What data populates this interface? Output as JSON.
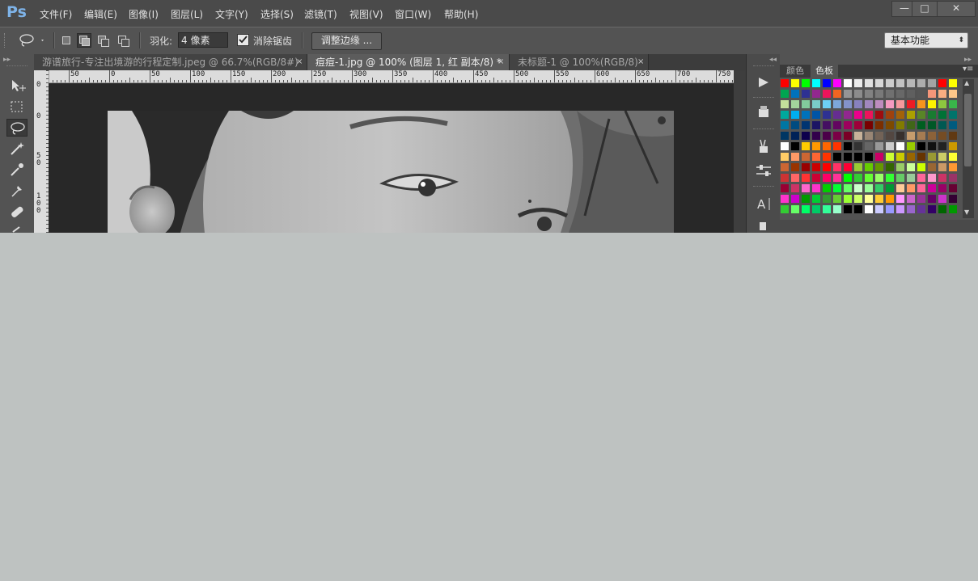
{
  "app": {
    "logo": "Ps",
    "menu": [
      "文件(F)",
      "编辑(E)",
      "图像(I)",
      "图层(L)",
      "文字(Y)",
      "选择(S)",
      "滤镜(T)",
      "视图(V)",
      "窗口(W)",
      "帮助(H)"
    ],
    "window_controls": {
      "minimize": "—",
      "maximize": "□",
      "close": "✕"
    }
  },
  "options": {
    "feather_label": "羽化:",
    "feather_value": "4 像素",
    "antialias_label": "消除锯齿",
    "antialias_checked": true,
    "refine_edge_label": "调整边缘 ...",
    "workspace": "基本功能"
  },
  "tabs": [
    {
      "label": "游谱旅行-专注出境游的行程定制.jpeg @ 66.7%(RGB/8#)",
      "close": "×",
      "active": false
    },
    {
      "label": "痘痘-1.jpg @ 100% (图层 1, 红 副本/8) *",
      "close": "×",
      "active": true
    },
    {
      "label": "未标题-1 @ 100%(RGB/8)",
      "close": "×",
      "active": false
    }
  ],
  "ruler": {
    "top_labels": [
      "50",
      "0",
      "50",
      "100",
      "150",
      "200",
      "250",
      "300",
      "350",
      "400",
      "450",
      "500",
      "550",
      "600",
      "650",
      "700",
      "750"
    ],
    "left_labels": [
      "0",
      "0",
      "5\n0",
      "1\n0\n0"
    ]
  },
  "panel": {
    "tabs": [
      "颜色",
      "色板"
    ],
    "active_tab": "色板",
    "collapse_arrows": "◂◂",
    "expand_arrows": "▸▸",
    "menu_icon": "▾≡"
  },
  "swatches": [
    "#ff0000",
    "#ffff00",
    "#00ff00",
    "#00ffff",
    "#0000ff",
    "#ff00ff",
    "#ffffff",
    "#ebebeb",
    "#e1e1e1",
    "#d7d7d7",
    "#cccccc",
    "#c2c2c2",
    "#b7b7b7",
    "#adadad",
    "#a3a3a3",
    "#ff0000",
    "#ffff00",
    "#00a651",
    "#0072bc",
    "#2e3192",
    "#92278f",
    "#ed145b",
    "#f26522",
    "#959595",
    "#8c8c8c",
    "#828282",
    "#797979",
    "#707070",
    "#686868",
    "#5f5f5f",
    "#555555",
    "#f69679",
    "#f9ad81",
    "#fdc689",
    "#c4df9b",
    "#a3d39c",
    "#82ca9c",
    "#7accc8",
    "#6dcff6",
    "#7da7d9",
    "#8393ca",
    "#8781bd",
    "#a187be",
    "#bd8cbf",
    "#f49ac1",
    "#f5989d",
    "#ed1c24",
    "#f7941d",
    "#fff200",
    "#8dc63f",
    "#39b54a",
    "#00a99d",
    "#00aeef",
    "#0072bc",
    "#0054a6",
    "#2e3192",
    "#662d91",
    "#92278f",
    "#ec008c",
    "#ed145b",
    "#9e0b0f",
    "#a0410d",
    "#a36209",
    "#aba000",
    "#598527",
    "#197b30",
    "#007236",
    "#00746b",
    "#0076a3",
    "#004b80",
    "#003471",
    "#1b1464",
    "#440e62",
    "#630460",
    "#9e005d",
    "#9e0039",
    "#790000",
    "#7b2e00",
    "#7d4900",
    "#827b00",
    "#406618",
    "#005e20",
    "#005826",
    "#005952",
    "#005b7f",
    "#003663",
    "#002157",
    "#0d004c",
    "#32004b",
    "#4b0049",
    "#7b0046",
    "#7a0026",
    "#c7b299",
    "#998675",
    "#736357",
    "#534741",
    "#37302d",
    "#c69c6d",
    "#a67c52",
    "#8c6239",
    "#754c24",
    "#603913",
    "#ffffff",
    "#000000",
    "#ffcc00",
    "#ff9900",
    "#ff6600",
    "#ff3300",
    "#000000",
    "#333333",
    "#666666",
    "#999999",
    "#cccccc",
    "#ffffff",
    "#99cc00",
    "#000000",
    "#111111",
    "#222222",
    "#cc9900",
    "#ffcc66",
    "#ff9966",
    "#cc6633",
    "#ff6633",
    "#ff3300",
    "#000000",
    "#000000",
    "#000000",
    "#000000",
    "#cc0066",
    "#ccff33",
    "#cccc00",
    "#996600",
    "#663300",
    "#999933",
    "#cccc66",
    "#ffff33",
    "#cc6633",
    "#993300",
    "#990000",
    "#cc0000",
    "#ff0000",
    "#ff3366",
    "#ff0033",
    "#99cc33",
    "#66cc00",
    "#669900",
    "#336600",
    "#99cc66",
    "#ccff99",
    "#ccff00",
    "#996633",
    "#cc9966",
    "#ff9933",
    "#cc3333",
    "#ff6666",
    "#ff3333",
    "#cc0033",
    "#ff0066",
    "#ff3399",
    "#00ff00",
    "#33cc33",
    "#66ff33",
    "#99ff66",
    "#33ff33",
    "#66cc66",
    "#99cc99",
    "#ff6699",
    "#ff99cc",
    "#cc3366",
    "#993366",
    "#990033",
    "#cc3366",
    "#ff66cc",
    "#ff33cc",
    "#00cc00",
    "#00ff33",
    "#66ff66",
    "#ccffcc",
    "#99ff99",
    "#33cc66",
    "#009933",
    "#ffcc99",
    "#ff9966",
    "#ff6699",
    "#cc0099",
    "#990066",
    "#660033",
    "#ff33cc",
    "#cc00cc",
    "#009900",
    "#00cc33",
    "#339933",
    "#66cc33",
    "#99ff33",
    "#ccff66",
    "#ffff99",
    "#ffcc33",
    "#ff9900",
    "#ff99ff",
    "#cc66cc",
    "#993399",
    "#660066",
    "#cc33cc",
    "#330033",
    "#33cc33",
    "#66ff66",
    "#00ff66",
    "#00cc66",
    "#33ff99",
    "#99ffcc",
    "#000000",
    "#000000",
    "#ffffff",
    "#ccccff",
    "#9999ff",
    "#cc99ff",
    "#9966cc",
    "#663399",
    "#330066",
    "#006600",
    "#009900"
  ]
}
